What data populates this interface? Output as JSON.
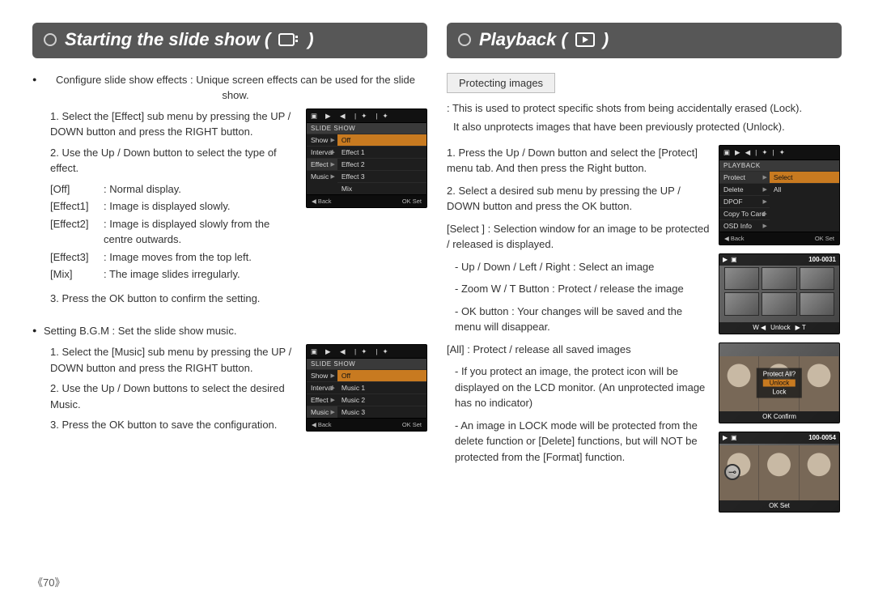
{
  "page_number": "《70》",
  "left": {
    "heading": "Starting the slide show (",
    "heading_close": ")",
    "s1": {
      "intro": "Configure slide show effects : Unique screen effects can be used for the slide show.",
      "step1": "1. Select the [Effect] sub menu by pressing the UP / DOWN button and press the RIGHT button.",
      "step2": "2. Use the Up / Down button to select the type of effect.",
      "defs": {
        "off_k": "[Off]",
        "off_v": ": Normal display.",
        "e1_k": "[Effect1]",
        "e1_v": ": Image is displayed slowly.",
        "e2_k": "[Effect2]",
        "e2_v": ": Image is displayed slowly from the centre outwards.",
        "e3_k": "[Effect3]",
        "e3_v": ": Image moves from the top left.",
        "mix_k": "[Mix]",
        "mix_v": ": The image slides irregularly."
      },
      "step3": "3. Press the OK button to confirm the setting."
    },
    "s2": {
      "intro": "Setting B.G.M : Set the slide show music.",
      "step1": "1. Select the [Music] sub menu by pressing the UP / DOWN button and press the RIGHT button.",
      "step2": "2. Use the Up / Down buttons to select the desired Music.",
      "step3": "3. Press the OK button to save the configuration."
    },
    "lcd_effect": {
      "title": "SLIDE SHOW",
      "menu": [
        "Show",
        "Interval",
        "Effect",
        "Music"
      ],
      "options": [
        "Off",
        "Effect 1",
        "Effect 2",
        "Effect 3",
        "Mix"
      ],
      "selected": "Off",
      "footer_back": "◀  Back",
      "footer_set": "OK  Set"
    },
    "lcd_music": {
      "title": "SLIDE SHOW",
      "menu": [
        "Show",
        "Interval",
        "Effect",
        "Music"
      ],
      "options": [
        "Off",
        "Music 1",
        "Music 2",
        "Music 3"
      ],
      "selected": "Off",
      "footer_back": "◀  Back",
      "footer_set": "OK  Set"
    }
  },
  "right": {
    "heading": "Playback (",
    "heading_close": ")",
    "subhead": "Protecting images",
    "desc1": ": This is used to protect specific shots from being accidentally erased (Lock).",
    "desc2": "It also unprotects images that have been previously protected (Unlock).",
    "step1": "1. Press the Up / Down button and select the [Protect] menu tab. And then press the Right button.",
    "step2": "2. Select a desired sub menu by pressing the UP / DOWN button and press the OK button.",
    "select_head": "[Select ] : Selection window for an image to be protected / released is displayed.",
    "select_l1": "- Up / Down / Left / Right : Select an image",
    "select_l2": "- Zoom W / T Button : Protect / release the image",
    "select_l3": "- OK button : Your changes will be saved and the menu will disappear.",
    "all_head": "[All] : Protect / release all saved images",
    "all_l1": "- If you protect an image, the protect icon will be displayed on the LCD monitor. (An unprotected image has no indicator)",
    "all_l2": "- An image in LOCK mode will be protected from the delete function or [Delete] functions, but will NOT be protected from the [Format] function.",
    "lcd_playback": {
      "title": "PLAYBACK",
      "menu": [
        "Protect",
        "Delete",
        "DPOF",
        "Copy To Card",
        "OSD Info"
      ],
      "options": [
        "Select",
        "All"
      ],
      "selected": "Select",
      "footer_back": "◀  Back",
      "footer_set": "OK  Set"
    },
    "thumb_select": {
      "file": "100-0031",
      "bbar_left": "W ◀",
      "bbar_mid": "Unlock",
      "bbar_right": "▶ T"
    },
    "thumb_all": {
      "title": "Protect All?",
      "opt_sel": "Unlock",
      "opt2": "Lock",
      "confirm": "OK  Confirm"
    },
    "thumb_locked": {
      "file": "100-0054",
      "ok": "OK  Set"
    }
  }
}
